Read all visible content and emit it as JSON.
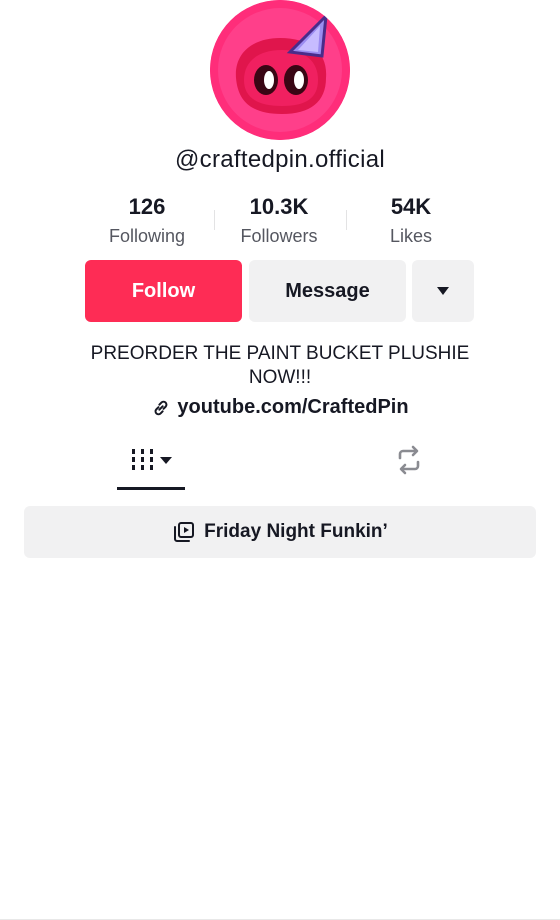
{
  "profile": {
    "username": "@craftedpin.official",
    "bio": "PREORDER THE PAINT BUCKET PLUSHIE NOW!!!",
    "link": "youtube.com/CraftedPin"
  },
  "stats": {
    "following": {
      "count": "126",
      "label": "Following"
    },
    "followers": {
      "count": "10.3K",
      "label": "Followers"
    },
    "likes": {
      "count": "54K",
      "label": "Likes"
    }
  },
  "actions": {
    "follow_label": "Follow",
    "message_label": "Message"
  },
  "tabs": [
    {
      "icon": "videos-grid-icon",
      "active": true
    },
    {
      "icon": "repost-icon",
      "active": false
    }
  ],
  "playlist": {
    "label": "Friday Night Funkin’"
  },
  "colors": {
    "accent": "#fe2c55",
    "avatar_ring": "#ff2d7a",
    "button_secondary": "#f1f1f2"
  }
}
